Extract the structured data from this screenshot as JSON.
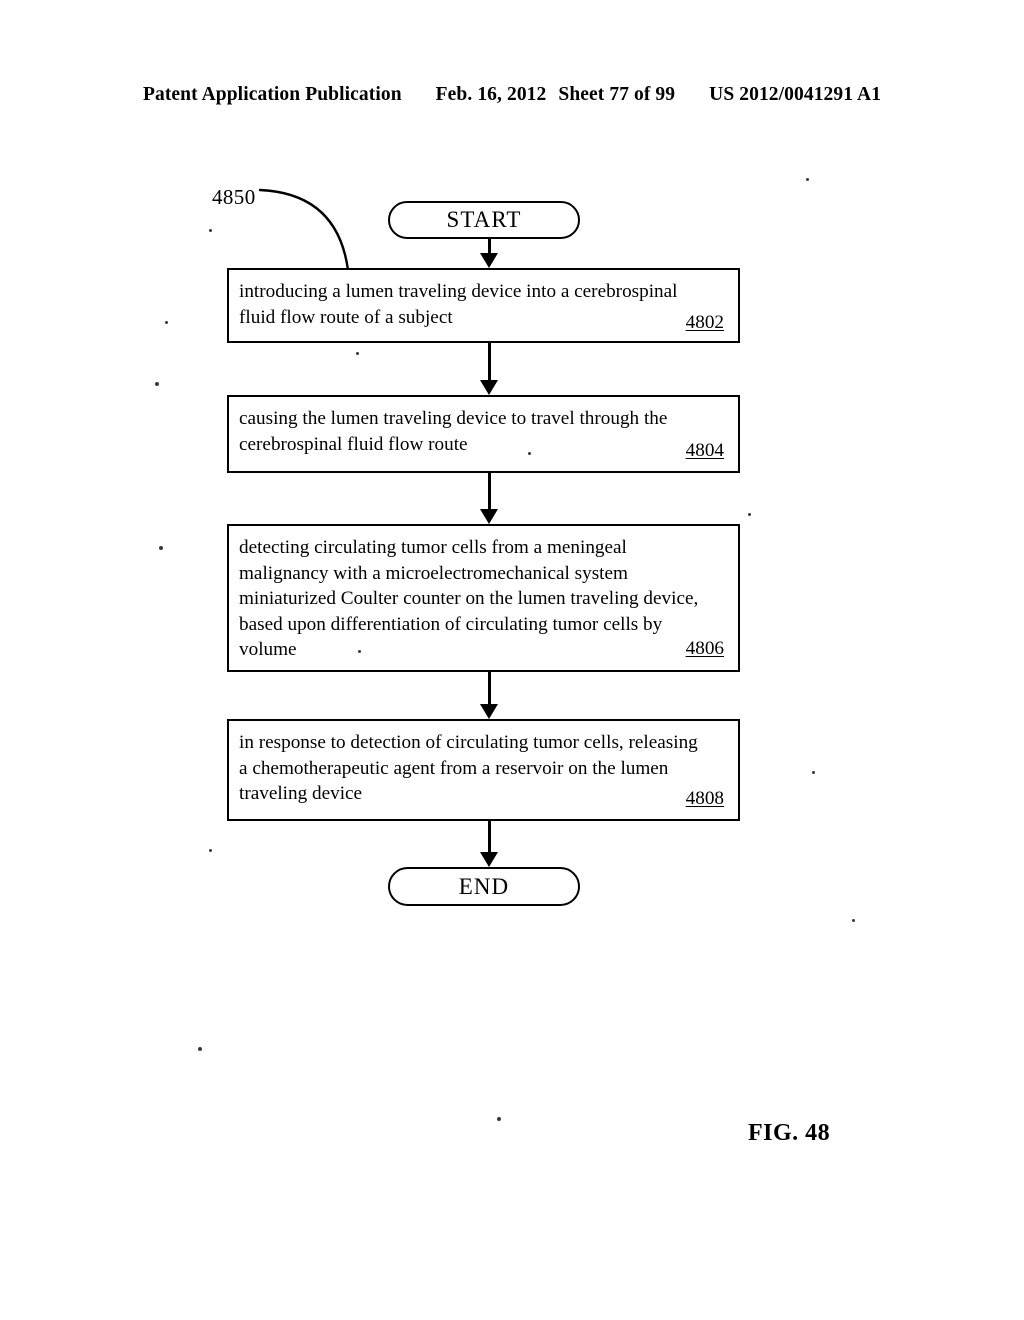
{
  "header": {
    "publication": "Patent Application Publication",
    "date": "Feb. 16, 2012",
    "sheet": "Sheet 77 of 99",
    "publication_number": "US 2012/0041291 A1"
  },
  "figure": {
    "caption": "FIG. 48",
    "reference_label": "4850"
  },
  "flowchart": {
    "start_label": "START",
    "end_label": "END",
    "steps": [
      {
        "text": "introducing a lumen traveling device into a cerebrospinal\nfluid flow route of a subject",
        "ref": "4802"
      },
      {
        "text": "causing the lumen traveling device to travel through the\ncerebrospinal fluid flow route",
        "ref": "4804"
      },
      {
        "text": "detecting circulating tumor cells from a meningeal\nmalignancy with a microelectromechanical system\nminiaturized Coulter counter on the lumen traveling device,\nbased upon differentiation of circulating tumor cells by\nvolume",
        "ref": "4806"
      },
      {
        "text": "in response to detection of circulating tumor cells, releasing\na chemotherapeutic agent from a reservoir on the lumen\ntraveling device",
        "ref": "4808"
      }
    ]
  }
}
